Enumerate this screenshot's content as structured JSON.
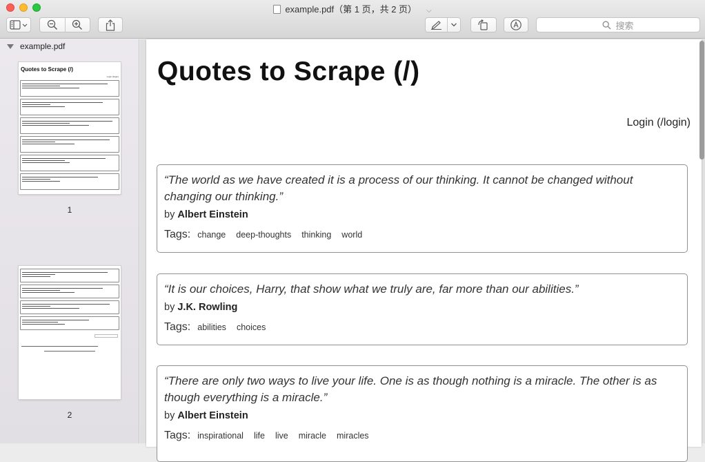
{
  "window": {
    "title": "example.pdf（第 1 页，共 2 页）"
  },
  "toolbar": {
    "search_placeholder": "搜索"
  },
  "sidebar": {
    "file_name": "example.pdf",
    "pages": [
      {
        "label": "1"
      },
      {
        "label": "2"
      }
    ],
    "thumb1_title": "Quotes to Scrape (/)",
    "thumb1_login": "Login (/login)"
  },
  "document": {
    "title": "Quotes to Scrape (/)",
    "login": "Login (/login)",
    "tags_label": "Tags:",
    "by_label": "by",
    "quotes": [
      {
        "text": "“The world as we have created it is a process of our thinking. It cannot be changed without changing our thinking.”",
        "author": "Albert Einstein",
        "tags": [
          "change",
          "deep-thoughts",
          "thinking",
          "world"
        ]
      },
      {
        "text": "“It is our choices, Harry, that show what we truly are, far more than our abilities.”",
        "author": "J.K. Rowling",
        "tags": [
          "abilities",
          "choices"
        ]
      },
      {
        "text": "“There are only two ways to live your life. One is as though nothing is a miracle. The other is as though everything is a miracle.”",
        "author": "Albert Einstein",
        "tags": [
          "inspirational",
          "life",
          "live",
          "miracle",
          "miracles"
        ]
      }
    ]
  }
}
